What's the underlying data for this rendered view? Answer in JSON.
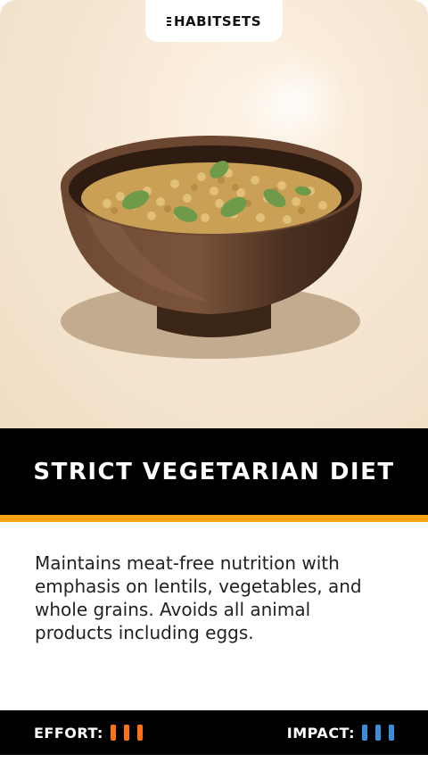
{
  "brand": {
    "logo_text": "HABITSETS"
  },
  "card": {
    "title": "STRICT VEGETARIAN DIET",
    "description": "Maintains meat-free nutrition with emphasis on lentils, vegetables, and whole grains. Avoids all animal products including eggs.",
    "image_icon": "lentil-bowl-illustration",
    "accent_color": "#fca311"
  },
  "ratings": {
    "effort": {
      "label": "EFFORT:",
      "level": 3,
      "max": 3,
      "color": "#f97316"
    },
    "impact": {
      "label": "IMPACT:",
      "level": 3,
      "max": 3,
      "color": "#3b8fd9"
    }
  }
}
